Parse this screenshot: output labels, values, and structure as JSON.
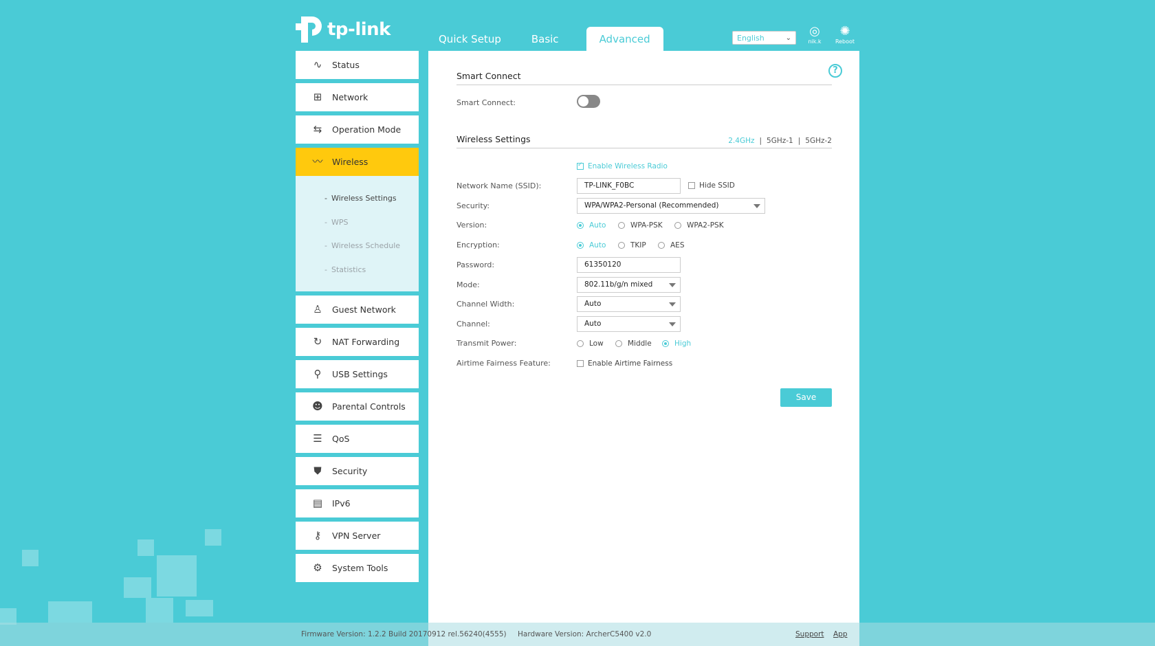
{
  "header": {
    "logo_text": "tp-link",
    "tabs": [
      {
        "label": "Quick Setup"
      },
      {
        "label": "Basic"
      },
      {
        "label": "Advanced"
      }
    ],
    "language": "English",
    "user_label": "nik.k",
    "reboot_label": "Reboot"
  },
  "sidebar": {
    "items": [
      {
        "label": "Status",
        "icon": "pulse-icon"
      },
      {
        "label": "Network",
        "icon": "network-icon"
      },
      {
        "label": "Operation Mode",
        "icon": "operation-mode-icon"
      },
      {
        "label": "Wireless",
        "icon": "wifi-icon"
      },
      {
        "label": "Guest Network",
        "icon": "guest-icon"
      },
      {
        "label": "NAT Forwarding",
        "icon": "nat-icon"
      },
      {
        "label": "USB Settings",
        "icon": "usb-icon"
      },
      {
        "label": "Parental Controls",
        "icon": "parental-icon"
      },
      {
        "label": "QoS",
        "icon": "qos-icon"
      },
      {
        "label": "Security",
        "icon": "shield-icon"
      },
      {
        "label": "IPv6",
        "icon": "ipv6-icon"
      },
      {
        "label": "VPN Server",
        "icon": "vpn-icon"
      },
      {
        "label": "System Tools",
        "icon": "gear-icon"
      }
    ],
    "wireless_sub": [
      {
        "label": "Wireless Settings"
      },
      {
        "label": "WPS"
      },
      {
        "label": "Wireless Schedule"
      },
      {
        "label": "Statistics"
      }
    ]
  },
  "main": {
    "smart_connect_title": "Smart Connect",
    "smart_connect_label": "Smart Connect:",
    "wireless_title": "Wireless Settings",
    "bands": [
      "2.4GHz",
      "5GHz-1",
      "5GHz-2"
    ],
    "enable_radio": "Enable Wireless Radio",
    "ssid_label": "Network Name (SSID):",
    "ssid_value": "TP-LINK_F0BC",
    "hide_ssid": "Hide SSID",
    "security_label": "Security:",
    "security_value": "WPA/WPA2-Personal (Recommended)",
    "version_label": "Version:",
    "version_options": [
      "Auto",
      "WPA-PSK",
      "WPA2-PSK"
    ],
    "encryption_label": "Encryption:",
    "encryption_options": [
      "Auto",
      "TKIP",
      "AES"
    ],
    "password_label": "Password:",
    "password_value": "61350120",
    "mode_label": "Mode:",
    "mode_value": "802.11b/g/n mixed",
    "channel_width_label": "Channel Width:",
    "channel_width_value": "Auto",
    "channel_label": "Channel:",
    "channel_value": "Auto",
    "transmit_label": "Transmit Power:",
    "transmit_options": [
      "Low",
      "Middle",
      "High"
    ],
    "airtime_label": "Airtime Fairness Feature:",
    "airtime_option": "Enable Airtime Fairness",
    "save_label": "Save",
    "help_label": "?"
  },
  "footer": {
    "firmware": "Firmware Version: 1.2.2 Build 20170912 rel.56240(4555)",
    "hardware": "Hardware Version: ArcherC5400 v2.0",
    "support": "Support",
    "app": "App"
  },
  "colors": {
    "background": "#4acbd6",
    "accent": "#4acbd6",
    "active_nav": "#ffc90d"
  }
}
